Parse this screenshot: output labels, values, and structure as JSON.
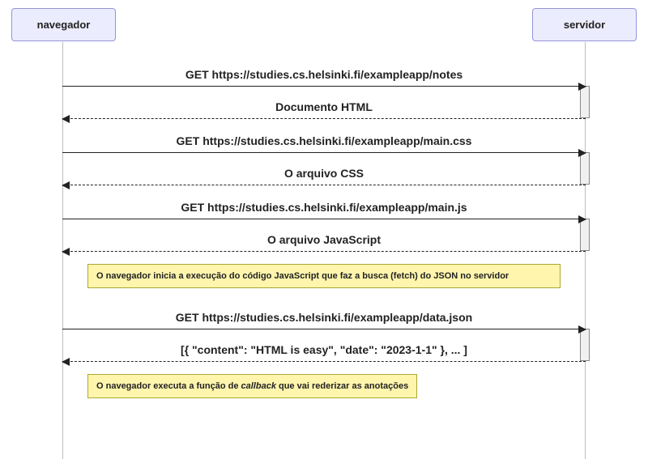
{
  "actors": {
    "left": "navegador",
    "right": "servidor"
  },
  "messages": {
    "m1": "GET https://studies.cs.helsinki.fi/exampleapp/notes",
    "r1": "Documento HTML",
    "m2": "GET https://studies.cs.helsinki.fi/exampleapp/main.css",
    "r2": "O arquivo CSS",
    "m3": "GET https://studies.cs.helsinki.fi/exampleapp/main.js",
    "r3": "O arquivo JavaScript",
    "m4": "GET https://studies.cs.helsinki.fi/exampleapp/data.json",
    "r4": "[{ \"content\": \"HTML is easy\", \"date\": \"2023-1-1\" }, ... ]"
  },
  "notes": {
    "n1": "O navegador inicia a execução do código JavaScript que faz a busca (fetch) do JSON  no servidor",
    "n2_pre": "O navegador executa a função de ",
    "n2_em": "callback",
    "n2_post": " que vai rederizar as anotações"
  }
}
